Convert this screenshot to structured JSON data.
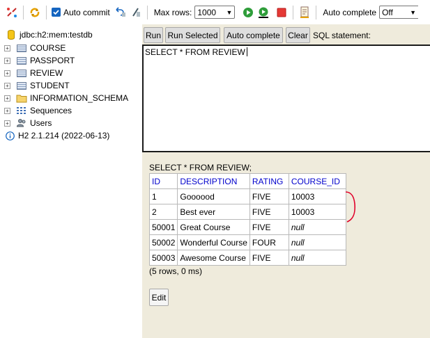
{
  "toolbar": {
    "auto_commit_label": "Auto commit",
    "max_rows_label": "Max rows:",
    "max_rows_value": "1000",
    "auto_complete_label": "Auto complete",
    "auto_complete_value": "Off"
  },
  "tree": {
    "connection": "jdbc:h2:mem:testdb",
    "items": [
      {
        "label": "COURSE"
      },
      {
        "label": "PASSPORT"
      },
      {
        "label": "REVIEW"
      },
      {
        "label": "STUDENT"
      },
      {
        "label": "INFORMATION_SCHEMA"
      },
      {
        "label": "Sequences"
      },
      {
        "label": "Users"
      }
    ],
    "version": "H2 2.1.214 (2022-06-13)"
  },
  "editor": {
    "buttons": {
      "run": "Run",
      "run_selected": "Run Selected",
      "auto_complete": "Auto complete",
      "clear": "Clear"
    },
    "label": "SQL statement:",
    "text": "SELECT * FROM REVIEW"
  },
  "result": {
    "sql": "SELECT * FROM REVIEW;",
    "columns": [
      "ID",
      "DESCRIPTION",
      "RATING",
      "COURSE_ID"
    ],
    "rows": [
      [
        "1",
        "Goooood",
        "FIVE",
        "10003"
      ],
      [
        "2",
        "Best ever",
        "FIVE",
        "10003"
      ],
      [
        "50001",
        "Great Course",
        "FIVE",
        "null"
      ],
      [
        "50002",
        "Wonderful Course",
        "FOUR",
        "null"
      ],
      [
        "50003",
        "Awesome Course",
        "FIVE",
        "null"
      ]
    ],
    "summary": "(5 rows, 0 ms)",
    "edit_label": "Edit"
  },
  "colors": {
    "panel_bg": "#efebdc",
    "header_link": "#0000cc",
    "annotation": "#e0002a"
  }
}
